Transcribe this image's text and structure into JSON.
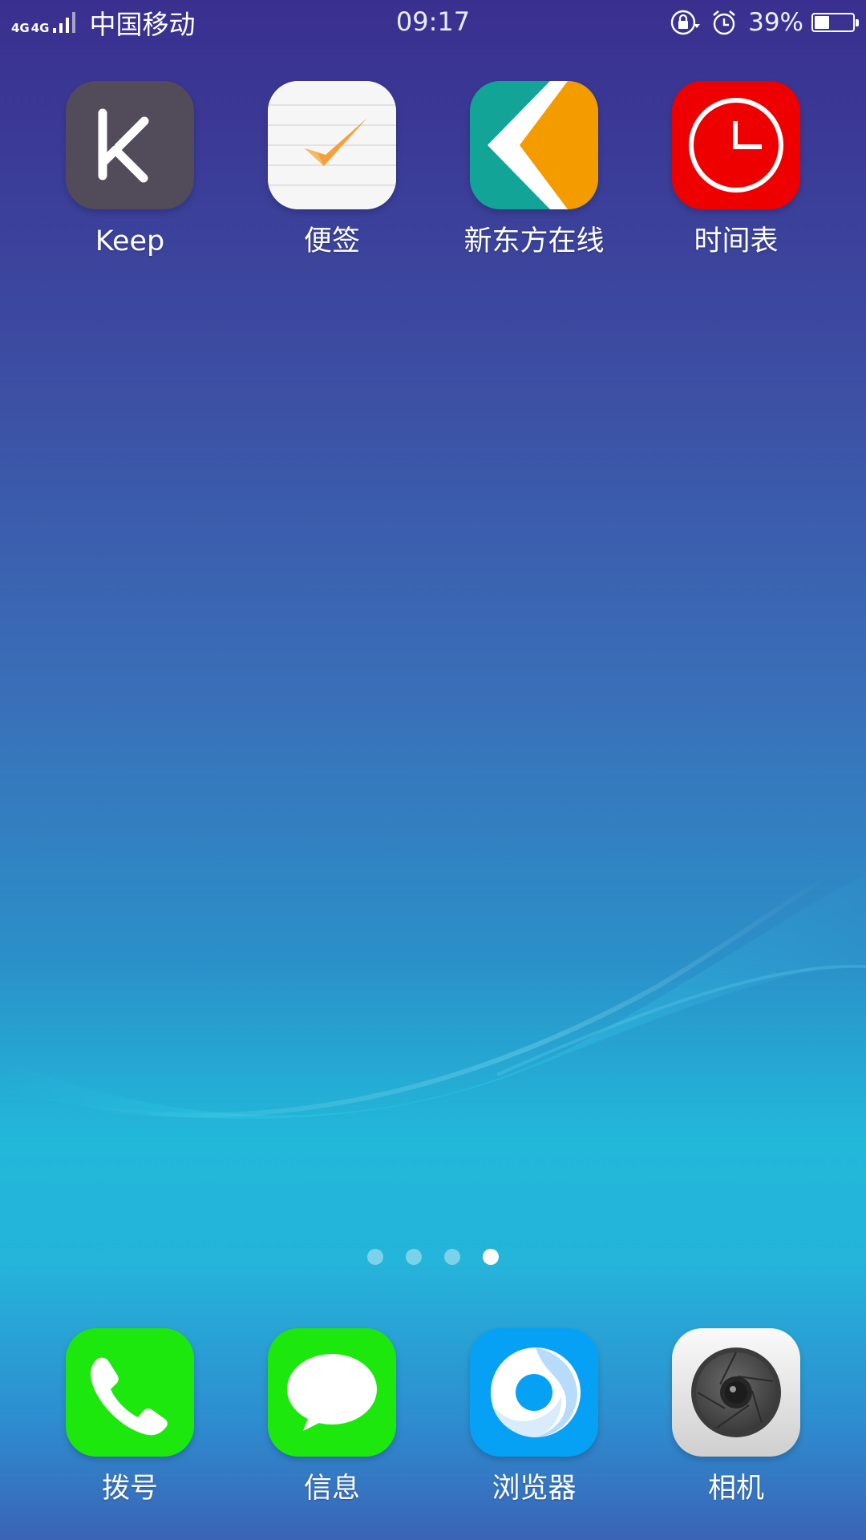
{
  "status_bar": {
    "network_1": "4G",
    "network_2": "4G",
    "carrier": "中国移动",
    "time": "09:17",
    "battery_percent_text": "39%",
    "battery_level": 0.39,
    "icons": [
      "signal-icon",
      "rotation-lock-icon",
      "alarm-icon",
      "battery-icon"
    ]
  },
  "home_apps": [
    {
      "label": "Keep",
      "icon": "keep-icon",
      "color": "#524b5a"
    },
    {
      "label": "便签",
      "icon": "notes-icon",
      "color": "#f4f4f4"
    },
    {
      "label": "新东方在线",
      "icon": "koolearn-icon",
      "color": "#13a396"
    },
    {
      "label": "时间表",
      "icon": "clock-icon",
      "color": "#ee0000"
    }
  ],
  "pager": {
    "page_count": 4,
    "active_page": 4
  },
  "dock_apps": [
    {
      "label": "拨号",
      "icon": "phone-icon",
      "color": "#1de80e"
    },
    {
      "label": "信息",
      "icon": "message-icon",
      "color": "#1de80e"
    },
    {
      "label": "浏览器",
      "icon": "browser-icon",
      "color": "#06a1f5"
    },
    {
      "label": "相机",
      "icon": "camera-icon",
      "color": "#e8e8e8"
    }
  ]
}
